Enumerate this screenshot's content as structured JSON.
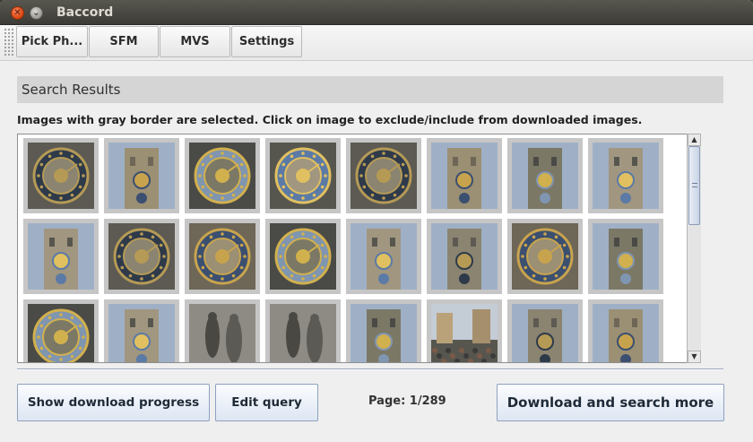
{
  "window": {
    "title": "Baccord"
  },
  "toolbar": {
    "tabs": [
      {
        "label": "Pick Ph..."
      },
      {
        "label": "SFM"
      },
      {
        "label": "MVS"
      },
      {
        "label": "Settings"
      }
    ]
  },
  "search_results": {
    "header": "Search Results",
    "instructions": "Images with gray border are selected. Click on image to exclude/include from downloaded images.",
    "thumbnails": [
      [
        "astronomical-clock-figures",
        "clock-tower-closeup",
        "clock-dial-detail",
        "clock-dial-grey",
        "calendar-dial-gold",
        "tower-facade",
        "tower-window-arches",
        "tower-night-sky"
      ],
      [
        "tower-clock-dark",
        "blue-dial-zodiac",
        "calendar-dial-monochrome",
        "blue-dial-angle",
        "tower-facade-day",
        "tower-clock-sunlit",
        "blue-dial-vivid",
        "tower-clock-overview"
      ],
      [
        "dial-closeup-blue",
        "old-town-hall-tower",
        "calendar-dial-statues",
        "statue-figures",
        "tower-golden-light",
        "crowd-square",
        "clock-tower-full",
        "clock-tower-blue"
      ]
    ]
  },
  "footer": {
    "show_progress_label": "Show download progress",
    "edit_query_label": "Edit query",
    "page_label": "Page: 1/289",
    "download_more_label": "Download and search more"
  },
  "colors": {
    "selected_border": "#c6c6c6",
    "header_bg": "#d5d5d5",
    "titlebar": "#3c3b37"
  }
}
